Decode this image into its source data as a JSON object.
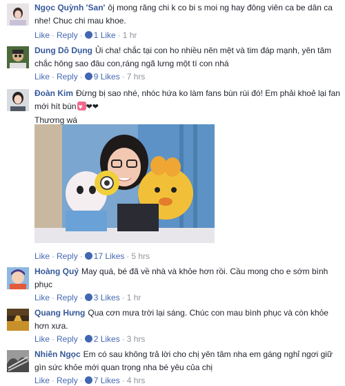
{
  "comments": [
    {
      "name": "Ngọc Quỳnh 'San'",
      "text": "ôj mong răng chi k co bi s moi ng hay đông viên ca be dân ca nhe! Chuc chi mau khoe.",
      "like": "Like",
      "reply": "Reply",
      "likes": "1 Like",
      "time": "1 hr"
    },
    {
      "name": "Dung Dô Dụng",
      "text": "Ủi cha! chắc tại con ho nhiều nên mệt và tim đáp mạnh, yên tâm chắc hông sao đâu con,ráng ngã lưng một tí con nhá",
      "like": "Like",
      "reply": "Reply",
      "likes": "9 Likes",
      "time": "7 hrs"
    },
    {
      "name": "Đoàn Kim",
      "text": "Đừng bị sao nhé, nhóc hứa ko làm fans bùn rùi đó! Em phải khoẻ lại fan mới hít bùn",
      "text2": "Thương wá",
      "like": "Like",
      "reply": "Reply",
      "likes": "17 Likes",
      "time": "5 hrs"
    },
    {
      "name": "Hoàng Quý",
      "text": "May quá, bé đã về nhà và khỏe hơn rồi. Cầu mong cho e sớm bình phục",
      "like": "Like",
      "reply": "Reply",
      "likes": "3 Likes",
      "time": "1 hr"
    },
    {
      "name": "Quang Hưng",
      "text": "Qua cơn mưa trời lại sáng. Chúc con mau bình phục và còn khỏe hơn xưa.",
      "like": "Like",
      "reply": "Reply",
      "likes": "2 Likes",
      "time": "3 hrs"
    },
    {
      "name": "Nhiên Ngọc",
      "text": "Em có sau không trả lời cho chị yên tâm nha em gáng nghỉ ngơi giữ gìn sức khỏe mới quan trọng nha bé yêu của chị",
      "like": "Like",
      "reply": "Reply",
      "likes": "7 Likes",
      "time": "4 hrs"
    }
  ],
  "sep": "·",
  "colors": {
    "name": "#365899",
    "link": "#4267b2",
    "meta": "#90949c"
  }
}
